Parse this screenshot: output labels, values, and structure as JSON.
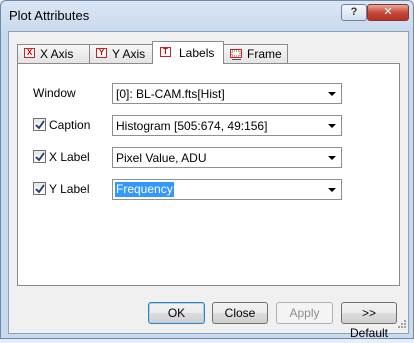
{
  "window": {
    "title": "Plot Attributes",
    "help_label": "?",
    "close_label": "✕"
  },
  "tabs": [
    {
      "label": "X Axis",
      "icon": "x-axis-icon",
      "glyph": "X",
      "active": false
    },
    {
      "label": "Y Axis",
      "icon": "y-axis-icon",
      "glyph": "Y",
      "active": false
    },
    {
      "label": "Labels",
      "icon": "text-icon",
      "glyph": "T",
      "active": true
    },
    {
      "label": "Frame",
      "icon": "frame-icon",
      "glyph": "",
      "active": false
    }
  ],
  "fields": {
    "window": {
      "label": "Window",
      "value": "[0]: BL-CAM.fts[Hist]"
    },
    "caption": {
      "label": "Caption",
      "checked": true,
      "value": "Histogram [505:674, 49:156]"
    },
    "xlabel": {
      "label": "X Label",
      "checked": true,
      "value": "Pixel Value, ADU"
    },
    "ylabel": {
      "label": "Y Label",
      "checked": true,
      "value": "Frequency",
      "selected": true
    }
  },
  "buttons": {
    "ok": "OK",
    "close": "Close",
    "apply": "Apply",
    "default": ">> Default"
  },
  "colors": {
    "selection": "#3399ff",
    "tab_icon_red": "#cc2222"
  }
}
